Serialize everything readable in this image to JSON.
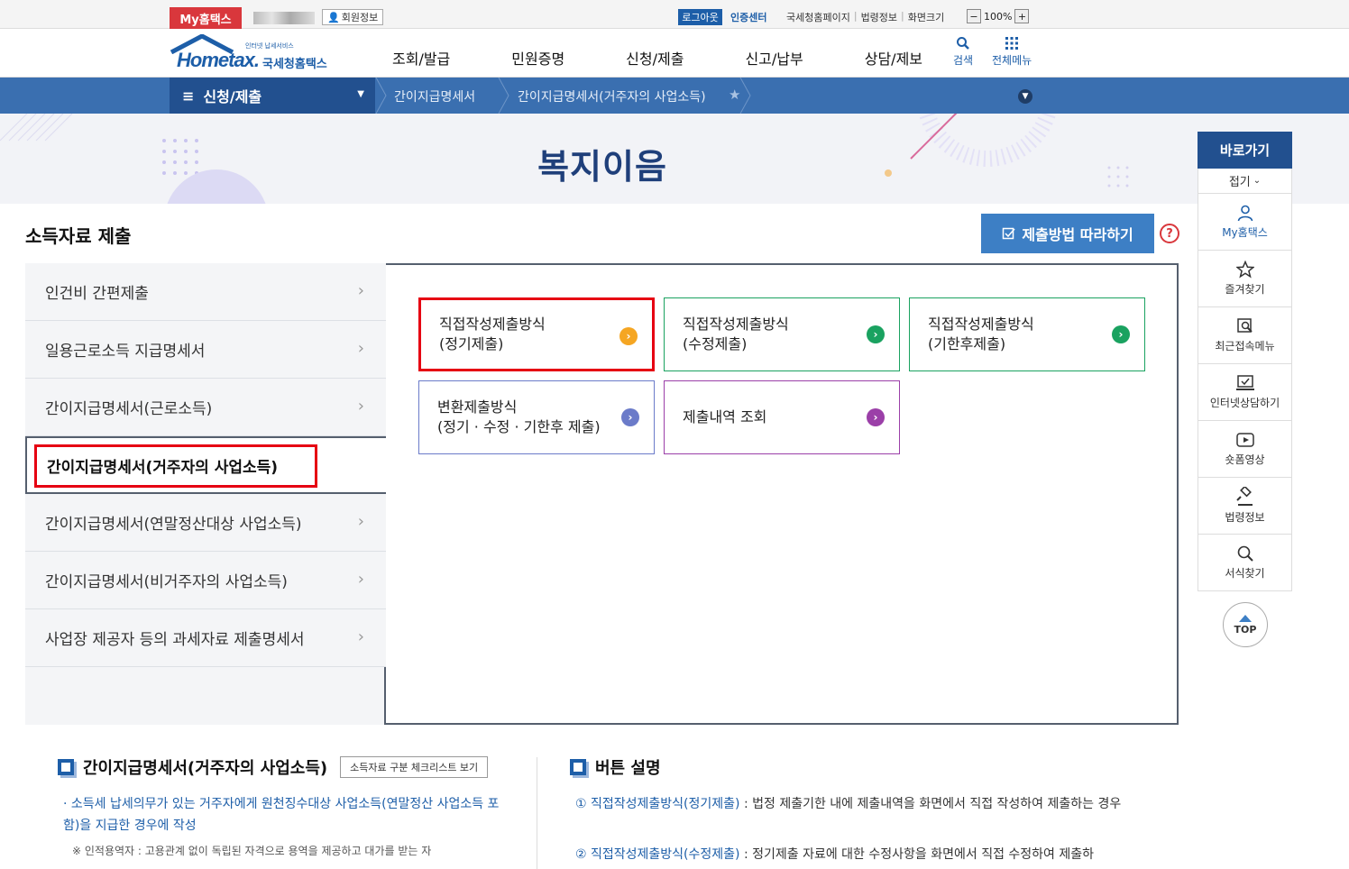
{
  "topbar": {
    "my_hometax": "My홈택스",
    "member_info": "회원정보",
    "logout": "로그아웃",
    "cert_center": "인증센터",
    "links": [
      "국세청홈페이지",
      "법령정보",
      "화면크기"
    ],
    "zoom_minus": "−",
    "zoom_level": "100%",
    "zoom_plus": "+"
  },
  "header": {
    "logo_main": "Hometax.",
    "logo_sub": "국세청홈택스",
    "logo_tiny": "인터넷 납세서비스",
    "nav": [
      "조회/발급",
      "민원증명",
      "신청/제출",
      "신고/납부",
      "상담/제보"
    ],
    "search_label": "검색",
    "allmenu_label": "전체메뉴"
  },
  "breadcrumb": {
    "main": "신청/제출",
    "items": [
      "간이지급명세서",
      "간이지급명세서(거주자의 사업소득)"
    ]
  },
  "banner": {
    "title": "복지이음"
  },
  "section": {
    "title": "소득자료 제출",
    "follow_button": "제출방법 따라하기",
    "help": "?"
  },
  "side_menu": [
    "인건비 간편제출",
    "일용근로소득 지급명세서",
    "간이지급명세서(근로소득)",
    "간이지급명세서(거주자의 사업소득)",
    "간이지급명세서(연말정산대상 사업소득)",
    "간이지급명세서(비거주자의 사업소득)",
    "사업장 제공자 등의 과세자료 제출명세서"
  ],
  "cards": [
    {
      "label": "직접작성제출방식\n(정기제출)",
      "border": "#d9d9d9",
      "go": "#f5a623"
    },
    {
      "label": "직접작성제출방식\n(수정제출)",
      "border": "#1aa260",
      "go": "#1aa260"
    },
    {
      "label": "직접작성제출방식\n(기한후제출)",
      "border": "#1aa260",
      "go": "#1aa260"
    },
    {
      "label": "변환제출방식\n(정기 · 수정 · 기한후 제출)",
      "border": "#6b7bc9",
      "go": "#6b7bc9"
    },
    {
      "label": "제출내역 조회",
      "border": "#9b3fa8",
      "go": "#9b3fa8"
    }
  ],
  "info_left": {
    "title": "간이지급명세서(거주자의 사업소득)",
    "checklist_button": "소득자료 구분 체크리스트 보기",
    "bullet": "· 소득세 납세의무가 있는 거주자에게 원천징수대상 사업소득(연말정산 사업소득 포함)을 지급한 경우에 작성",
    "note": "※ 인적용역자 : 고용관계 없이 독립된 자격으로 용역을 제공하고 대가를 받는 자"
  },
  "info_right": {
    "title": "버튼 설명",
    "items": [
      {
        "num": "①",
        "name": "직접작성제출방식(정기제출)",
        "desc": " : 법정 제출기한 내에 제출내역을 화면에서 직접 작성하여 제출하는 경우"
      },
      {
        "num": "②",
        "name": "직접작성제출방식(수정제출)",
        "desc": " : 정기제출 자료에 대한 수정사항을 화면에서 직접 수정하여 제출하"
      }
    ]
  },
  "quick_panel": {
    "title": "바로가기",
    "fold": "접기",
    "items": [
      "My홈택스",
      "즐겨찾기",
      "최근접속메뉴",
      "인터넷상담하기",
      "숏폼영상",
      "법령정보",
      "서식찾기"
    ],
    "top": "TOP"
  }
}
